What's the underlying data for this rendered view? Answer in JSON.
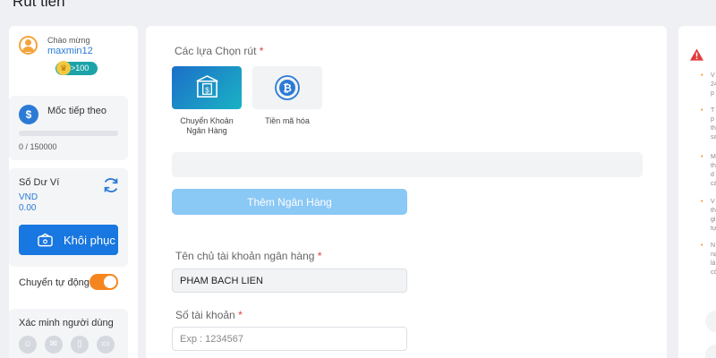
{
  "page": {
    "title": "Rút tiền"
  },
  "sidebar": {
    "welcome_label": "Chào mừng",
    "username": "maxmin12",
    "vip_badge": ">100",
    "milestone": {
      "label": "Mốc tiếp theo",
      "progress_text": "0 / 150000",
      "progress_fraction": 0
    },
    "wallet": {
      "label": "Số Dư Ví",
      "currency": "VND",
      "balance": "0.00",
      "restore_label": "Khôi phục"
    },
    "auto_transfer": {
      "label": "Chuyển tự động",
      "enabled": true
    },
    "verify": {
      "label": "Xác minh người dùng"
    }
  },
  "form": {
    "methods_label": "Các lựa Chọn rút",
    "methods": [
      {
        "name": "Chuyển Khoản\nNgân Hàng",
        "selected": true
      },
      {
        "name": "Tiền mã hóa",
        "selected": false
      }
    ],
    "add_bank_label": "Thêm Ngân Hàng",
    "holder_label": "Tên chủ tài khoản ngân hàng",
    "holder_value": "PHAM BACH LIEN",
    "account_label": "Số tài khoản",
    "account_placeholder": "Exp : 1234567",
    "required_mark": "*"
  },
  "notice": {
    "items": [
      {
        "lines": [
          "V",
          "24",
          "p"
        ]
      },
      {
        "lines": [
          "T",
          "p",
          "th",
          "sa"
        ]
      },
      {
        "lines": [
          "M",
          "th",
          "d",
          "cá"
        ]
      },
      {
        "lines": [
          "V",
          "th",
          "gi",
          "tự"
        ]
      },
      {
        "lines": [
          "N",
          "nạ",
          "lá",
          "có"
        ]
      }
    ]
  },
  "colors": {
    "primary": "#1877e0",
    "accent": "#f5861f",
    "error": "#e23b3b",
    "link": "#2b7bd6"
  }
}
